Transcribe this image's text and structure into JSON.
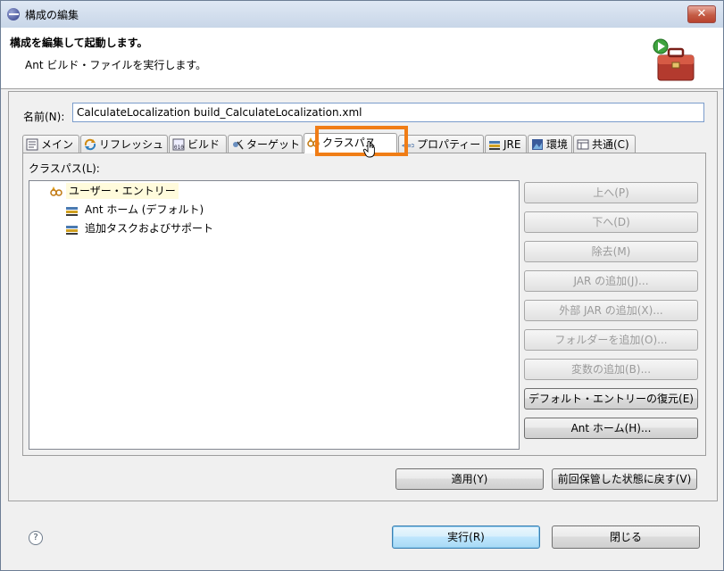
{
  "window": {
    "title": "構成の編集"
  },
  "header": {
    "title": "構成を編集して起動します。",
    "description": "Ant ビルド・ファイルを実行します。"
  },
  "name_field": {
    "label": "名前(N):",
    "value": "CalculateLocalization build_CalculateLocalization.xml"
  },
  "tabs": [
    {
      "label": "メイン",
      "icon": "main-tab-icon"
    },
    {
      "label": "リフレッシュ",
      "icon": "refresh-icon"
    },
    {
      "label": "ビルド",
      "icon": "build-icon"
    },
    {
      "label": "ターゲット",
      "icon": "target-icon"
    },
    {
      "label": "クラスパス",
      "icon": "classpath-icon",
      "active": true
    },
    {
      "label": "プロパティー",
      "icon": "properties-icon"
    },
    {
      "label": "JRE",
      "icon": "jre-icon"
    },
    {
      "label": "環境",
      "icon": "environment-icon"
    },
    {
      "label": "共通(C)",
      "icon": "common-icon"
    }
  ],
  "classpath": {
    "label": "クラスパス(L):",
    "tree": {
      "root": "ユーザー・エントリー",
      "children": [
        "Ant ホーム (デフォルト)",
        "追加タスクおよびサポート"
      ]
    },
    "buttons": {
      "up": "上へ(P)",
      "down": "下へ(D)",
      "remove": "除去(M)",
      "add_jar": "JAR の追加(J)...",
      "add_external_jar": "外部 JAR の追加(X)...",
      "add_folder": "フォルダーを追加(O)...",
      "add_variable": "変数の追加(B)...",
      "restore_default": "デフォルト・エントリーの復元(E)",
      "ant_home": "Ant ホーム(H)..."
    }
  },
  "actions": {
    "apply": "適用(Y)",
    "revert": "前回保管した状態に戻す(V)",
    "run": "実行(R)",
    "close": "閉じる"
  },
  "help": {
    "symbol": "?"
  },
  "colors": {
    "highlight": "#f07d16",
    "accent": "#3c7fb1",
    "title_bar": "#c8d6e8"
  }
}
